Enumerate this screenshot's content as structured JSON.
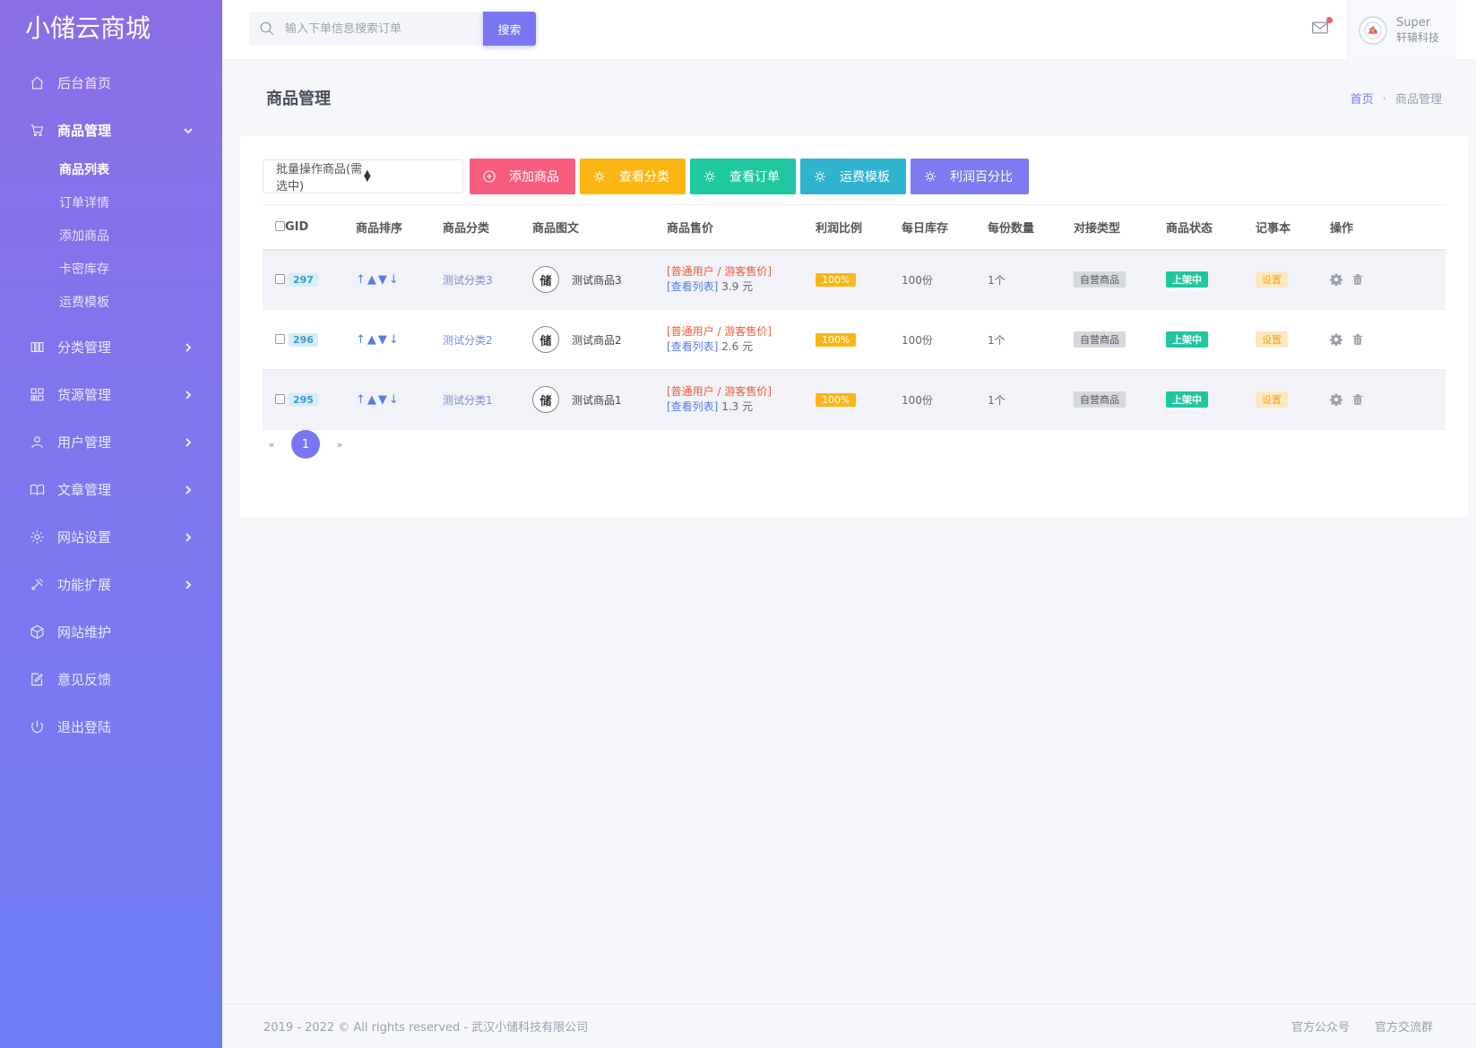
{
  "brand": "小储云商城",
  "nav": {
    "items": [
      {
        "label": "后台首页",
        "icon": "home-icon"
      },
      {
        "label": "商品管理",
        "icon": "cart-icon"
      },
      {
        "label": "分类管理",
        "icon": "columns-icon"
      },
      {
        "label": "货源管理",
        "icon": "grid-icon"
      },
      {
        "label": "用户管理",
        "icon": "user-icon"
      },
      {
        "label": "文章管理",
        "icon": "book-icon"
      },
      {
        "label": "网站设置",
        "icon": "gear-icon"
      },
      {
        "label": "功能扩展",
        "icon": "tools-icon"
      },
      {
        "label": "网站维护",
        "icon": "box-icon"
      },
      {
        "label": "意见反馈",
        "icon": "edit-icon"
      },
      {
        "label": "退出登陆",
        "icon": "power-icon"
      }
    ],
    "sub": [
      "商品列表",
      "订单详情",
      "添加商品",
      "卡密库存",
      "运费模板"
    ]
  },
  "search": {
    "placeholder": "输入下单信息搜索订单",
    "button": "搜索"
  },
  "user": {
    "name": "Super",
    "org": "轩辕科技"
  },
  "page": {
    "title": "商品管理",
    "breadcrumb_home": "首页",
    "breadcrumb_current": "商品管理"
  },
  "toolbar": {
    "batch": "批量操作商品(需选中)",
    "add": "添加商品",
    "view_category": "查看分类",
    "view_order": "查看订单",
    "shipping": "运费模板",
    "profit": "利润百分比"
  },
  "table": {
    "headers": [
      "GID",
      "商品排序",
      "商品分类",
      "商品图文",
      "商品售价",
      "利润比例",
      "每日库存",
      "每份数量",
      "对接类型",
      "商品状态",
      "记事本",
      "操作"
    ],
    "sort_glyphs": "↑▲▼↓",
    "price_label": "[普通用户 / 游客售价]",
    "price_link": "[查看列表]",
    "logo_text": "储",
    "rows": [
      {
        "gid": "297",
        "category": "测试分类3",
        "name": "测试商品3",
        "price": "3.9 元",
        "profit": "100%",
        "stock": "100份",
        "qty": "1个",
        "type": "自营商品",
        "status": "上架中",
        "note": "设置"
      },
      {
        "gid": "296",
        "category": "测试分类2",
        "name": "测试商品2",
        "price": "2.6 元",
        "profit": "100%",
        "stock": "100份",
        "qty": "1个",
        "type": "自营商品",
        "status": "上架中",
        "note": "设置"
      },
      {
        "gid": "295",
        "category": "测试分类1",
        "name": "测试商品1",
        "price": "1.3 元",
        "profit": "100%",
        "stock": "100份",
        "qty": "1个",
        "type": "自营商品",
        "status": "上架中",
        "note": "设置"
      }
    ]
  },
  "pager": {
    "prev": "«",
    "current": "1",
    "next": "»"
  },
  "footer": {
    "copyright": "2019 - 2022 © All rights reserved - 武汉小储科技有限公司",
    "link1": "官方公众号",
    "link2": "官方交流群"
  }
}
